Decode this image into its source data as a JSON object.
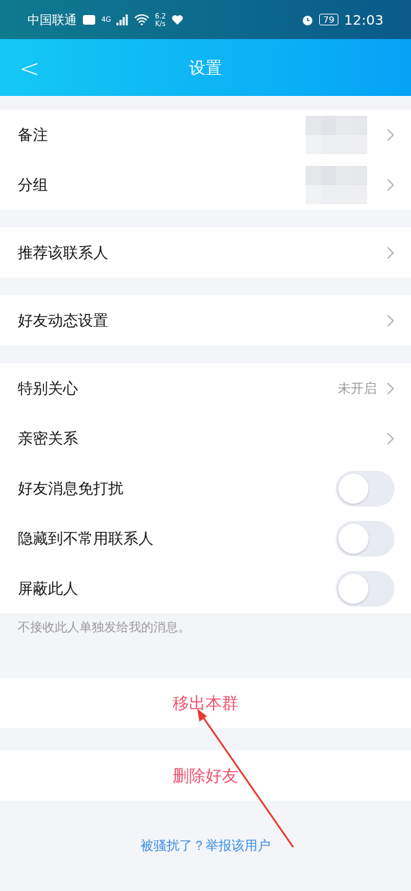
{
  "status_bar": {
    "carrier": "中国联通",
    "network": "4G",
    "speed": "6.2",
    "speed_unit": "K/s",
    "battery": "79",
    "time": "12:03"
  },
  "nav": {
    "back": "<",
    "title": "设置"
  },
  "groups": [
    {
      "rows": [
        {
          "kind": "link",
          "label": "备注",
          "redacted": true
        },
        {
          "kind": "link",
          "label": "分组",
          "redacted": true
        }
      ]
    },
    {
      "rows": [
        {
          "kind": "link",
          "label": "推荐该联系人",
          "redacted": false
        }
      ]
    },
    {
      "rows": [
        {
          "kind": "link",
          "label": "好友动态设置",
          "redacted": false
        }
      ]
    },
    {
      "rows": [
        {
          "kind": "link",
          "label": "特别关心",
          "value": "未开启",
          "redacted": false
        },
        {
          "kind": "link",
          "label": "亲密关系",
          "redacted": false
        },
        {
          "kind": "toggle",
          "label": "好友消息免打扰",
          "on": false
        },
        {
          "kind": "toggle",
          "label": "隐藏到不常用联系人",
          "on": false
        },
        {
          "kind": "toggle",
          "label": "屏蔽此人",
          "on": false
        }
      ],
      "note": "不接收此人单独发给我的消息。"
    }
  ],
  "actions": [
    "移出本群",
    "删除好友"
  ],
  "report_link": "被骚扰了？举报该用户",
  "annotation": {
    "kind": "arrow"
  }
}
